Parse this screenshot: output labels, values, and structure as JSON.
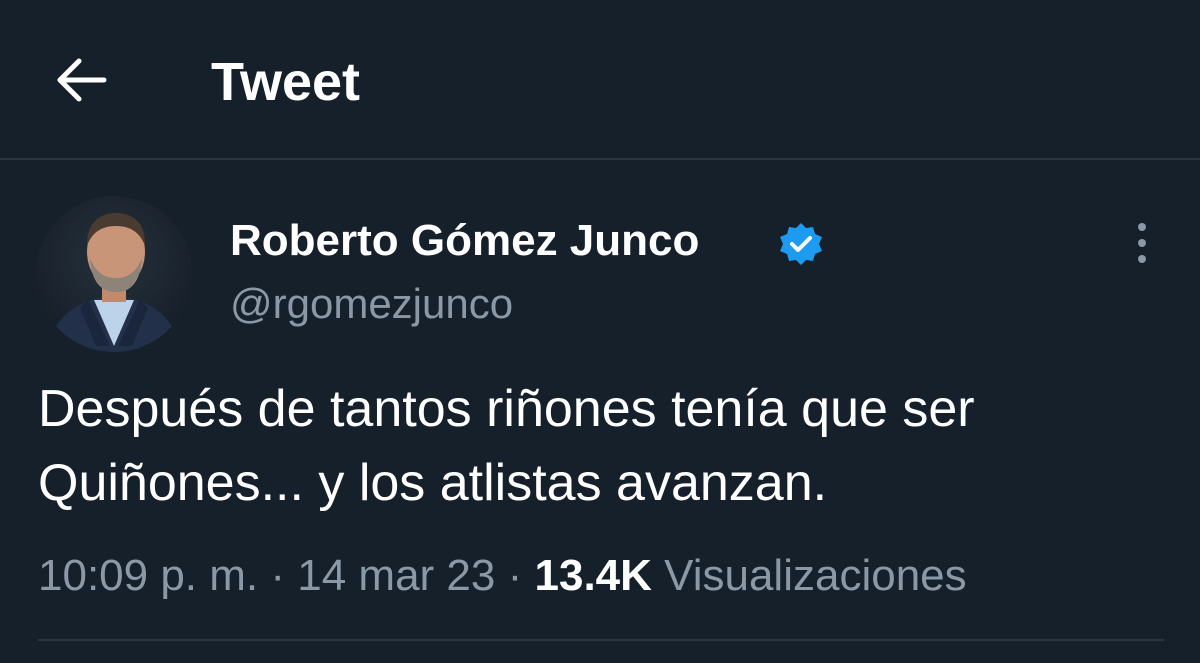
{
  "header": {
    "title": "Tweet",
    "back_icon": "arrow-left-icon"
  },
  "tweet": {
    "author_name": "Roberto Gómez Junco",
    "verified_icon": "verified-badge-icon",
    "verified_color": "#1d9bf0",
    "handle": "@rgomezjunco",
    "more_icon": "more-vertical-icon",
    "text_line1": "Después de tantos riñones tenía que ser",
    "text_line2": "Quiñones... y los atlistas avanzan.",
    "time": "10:09 p. m.",
    "separator": "·",
    "date": "14 mar 23",
    "views_count": "13.4K",
    "views_label": "Visualizaciones"
  },
  "colors": {
    "background": "#15202b",
    "secondary_text": "#8b98a5",
    "divider": "#2b3640"
  }
}
